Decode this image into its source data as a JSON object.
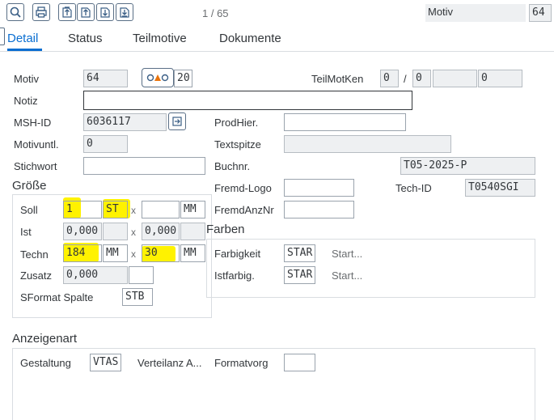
{
  "toolbar": {
    "buttons": [
      {
        "icon": "zoom-icon"
      },
      {
        "icon": "print-icon"
      },
      {
        "icon": "first-page-icon"
      },
      {
        "icon": "previous-page-icon"
      },
      {
        "icon": "next-page-icon"
      },
      {
        "icon": "last-page-icon"
      }
    ],
    "pager": "1 / 65",
    "motiv_label": "Motiv",
    "motiv_value": "64"
  },
  "tabs": [
    "Detail",
    "Status",
    "Teilmotive",
    "Dokumente"
  ],
  "form": {
    "motiv_label": "Motiv",
    "motiv_value": "64",
    "motiv_num": "20",
    "teilmotken_label": "TeilMotKen",
    "teilmotken_v1": "0",
    "teilmotken_sep": "/",
    "teilmotken_v2": "0",
    "teilmotken_v3": "",
    "teilmotken_v4": "0",
    "notiz_label": "Notiz",
    "notiz_value": "",
    "mshid_label": "MSH-ID",
    "mshid_value": "6036117",
    "prodhier_label": "ProdHier.",
    "prodhier_value": "",
    "motivuntl_label": "Motivuntl.",
    "motivuntl_value": "0",
    "textspitze_label": "Textspitze",
    "textspitze_value": "",
    "stichwort_label": "Stichwort",
    "stichwort_value": "",
    "buchnr_label": "Buchnr.",
    "buchnr_value": "T05-2025-P",
    "fremdlogo_label": "Fremd-Logo",
    "fremdlogo_value": "",
    "techid_label": "Tech-ID",
    "techid_value": "T0540SGI",
    "fremdanznr_label": "FremdAnzNr",
    "fremdanznr_value": ""
  },
  "groesse": {
    "title": "Größe",
    "soll_label": "Soll",
    "soll_value": "1",
    "soll_unit": "ST",
    "soll_x": "x",
    "soll_h": "",
    "soll_h_unit": "MM",
    "ist_label": "Ist",
    "ist_value": "0,000",
    "ist_unit": "",
    "ist_x": "x",
    "ist_h": "0,000",
    "ist_h_unit": "",
    "techn_label": "Techn",
    "techn_value": "184",
    "techn_unit": "MM",
    "techn_x": "x",
    "techn_h": "30",
    "techn_h_unit": "MM",
    "zusatz_label": "Zusatz",
    "zusatz_value": "0,000",
    "zusatz_extra": "",
    "sformat_label": "SFormat Spalte",
    "sformat_value": "STB"
  },
  "farben": {
    "title": "Farben",
    "farbigkeit_label": "Farbigkeit",
    "farbigkeit_value": "STAR",
    "farbigkeit_text": "Start...",
    "istfarbig_label": "Istfarbig.",
    "istfarbig_value": "STAR",
    "istfarbig_text": "Start..."
  },
  "anzeigenart": {
    "title": "Anzeigenart",
    "gestaltung_label": "Gestaltung",
    "gestaltung_value": "VTAS",
    "verteilanz_label": "Verteilanz A...",
    "formatvorg_label": "Formatvorg",
    "formatvorg_value": ""
  },
  "colors": {
    "accent": "#0a6ed1",
    "highlight": "#fff200"
  }
}
